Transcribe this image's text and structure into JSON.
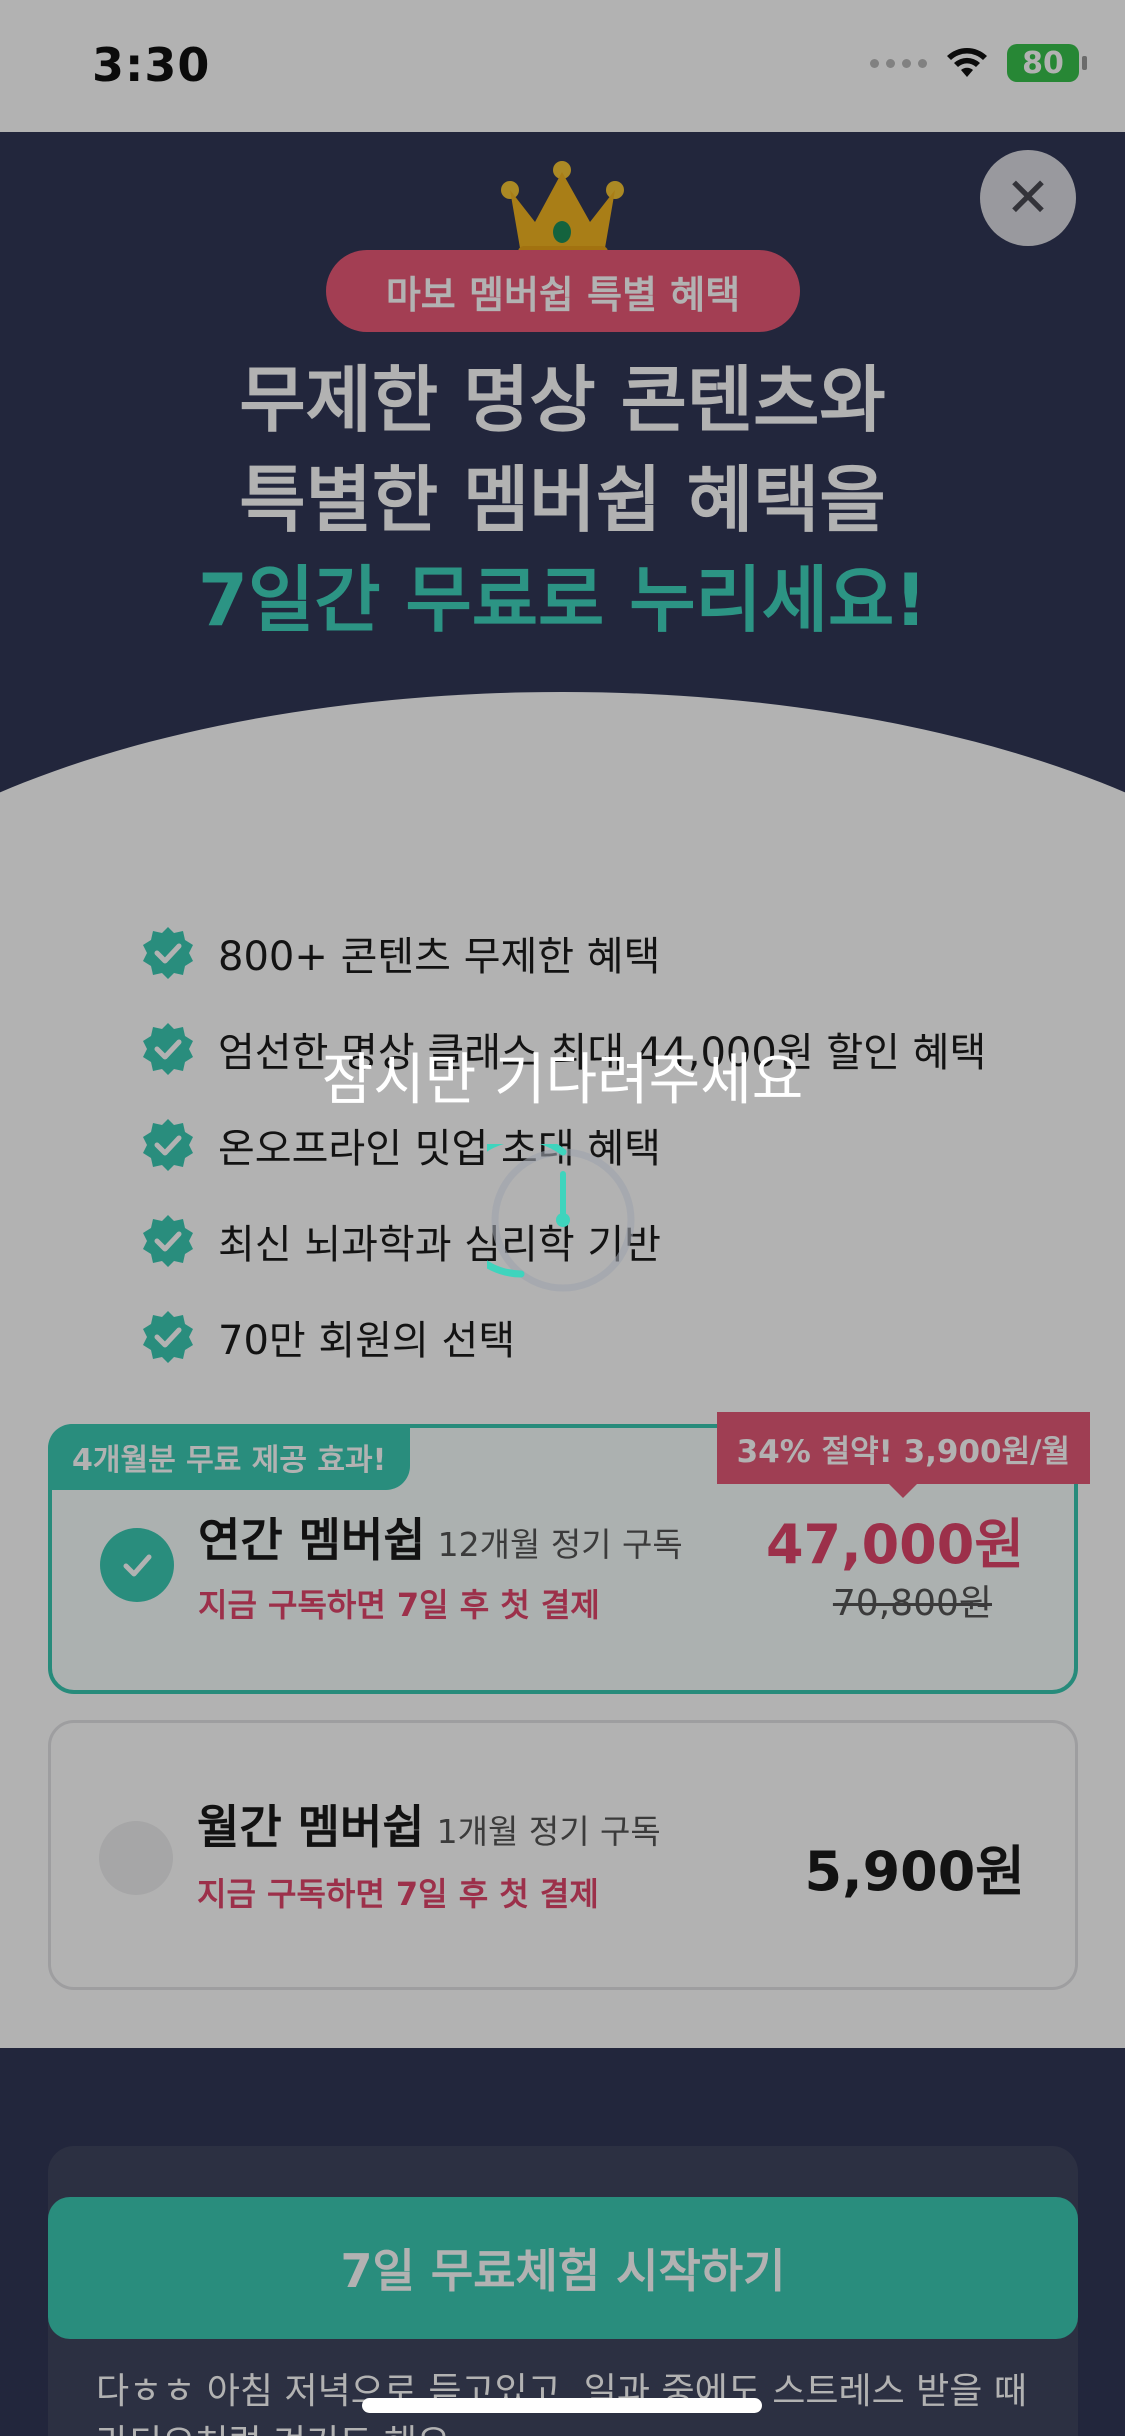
{
  "status_bar": {
    "time": "3:30",
    "battery": "80"
  },
  "hero": {
    "badge": "마보 멤버쉽 특별 혜택",
    "title_line1": "무제한 명상 콘텐츠와",
    "title_line2": "특별한 멤버쉽 혜택을",
    "title_line3": "7일간 무료로 누리세요!"
  },
  "benefits": [
    {
      "label": "800+ 콘텐츠 무제한 혜택"
    },
    {
      "label": "엄선한 명상 클래스 최대 44,000원 할인 혜택"
    },
    {
      "label": "온오프라인 밋업 초대 혜택"
    },
    {
      "label": "최신 뇌과학과 심리학 기반"
    },
    {
      "label": "70만 회원의 선택"
    }
  ],
  "plans": {
    "annual": {
      "free_badge": "4개월분 무료 제공 효과!",
      "save_badge": "34% 절약! 3,900원/월",
      "name": "연간 멤버쉽",
      "sub": "12개월 정기 구독",
      "note": "지금 구독하면 7일 후 첫 결제",
      "price": "47,000원",
      "original_price": "70,800원",
      "selected": true
    },
    "monthly": {
      "name": "월간 멤버쉽",
      "sub": "1개월 정기 구독",
      "note": "지금 구독하면 7일 후 첫 결제",
      "price": "5,900원",
      "selected": false
    }
  },
  "review": {
    "text": "다ㅎㅎ 아침 저녁으로 듣고있고, 일과 중에도 스트레스 받을 때 라디오처럼 켜기도 해요."
  },
  "cta": {
    "label": "7일 무료체험 시작하기"
  },
  "loading": {
    "message": "잠시만 기다려주세요"
  },
  "colors": {
    "accent": "#3ccab4",
    "pink": "#e0466b",
    "navy": "#313756"
  },
  "icons": [
    "crown-icon",
    "close-icon",
    "check-badge-icon",
    "spinner-icon",
    "wifi-icon",
    "battery-icon"
  ]
}
